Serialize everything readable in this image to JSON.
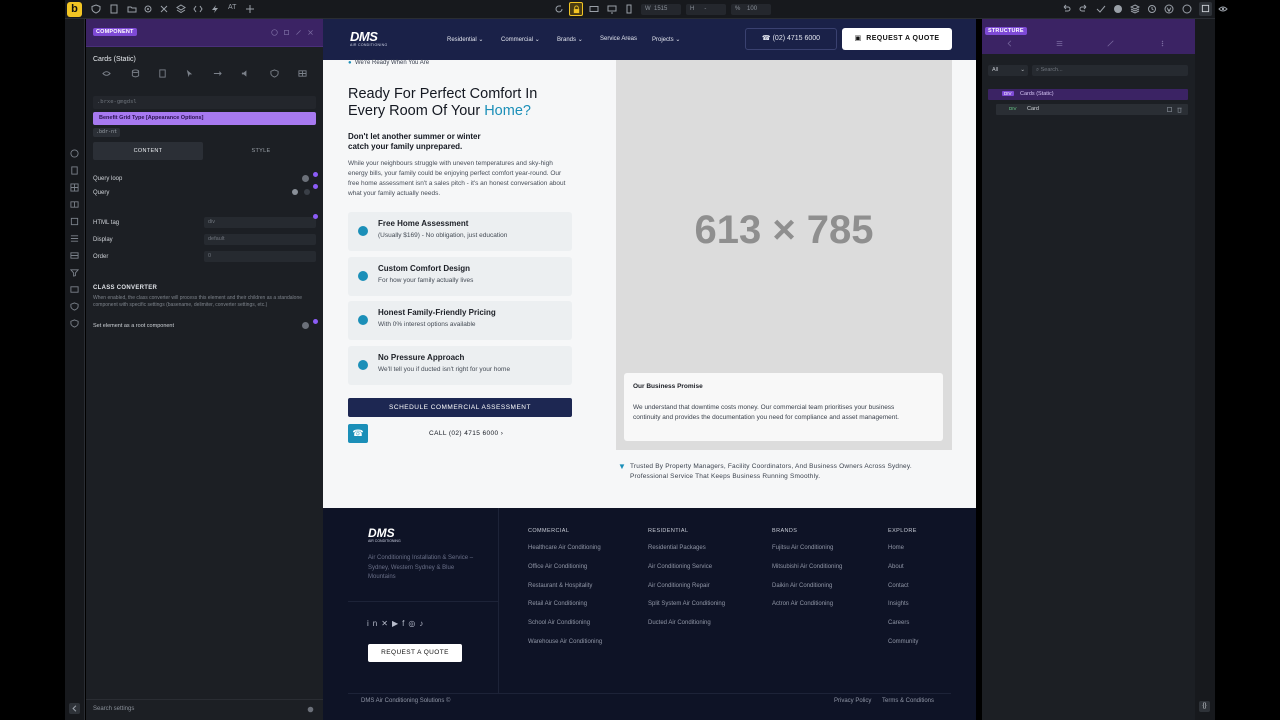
{
  "topbar": {
    "logo": "b",
    "mode": "AT",
    "width_value": "1515",
    "height_value": "-",
    "zoom_value": "100"
  },
  "left_panel": {
    "badge": "COMPONENT",
    "title": "Cards (Static)",
    "class_field": ".brxe-gmgdsl",
    "template_bar": "Benefit Grid Type [Appearance Options]",
    "tag_chip": ".bdr-nt",
    "tabs": {
      "content": "CONTENT",
      "style": "STYLE"
    },
    "fields": {
      "query_loop": "Query loop",
      "query": "Query",
      "html_tag": "HTML tag",
      "html_tag_value": "div",
      "display": "Display",
      "display_value": "default",
      "order": "Order",
      "order_value": "0"
    },
    "class_converter": {
      "heading": "CLASS CONVERTER",
      "desc": "When enabled, the class converter will process this element and their children as a standalone component with specific settings (basename, delimiter, converter settings, etc.)",
      "root_label": "Set element as a root component"
    },
    "search_placeholder": "Search settings"
  },
  "site": {
    "brand": "DMS",
    "brand_sub": "AIR CONDITIONING",
    "nav": [
      "Residential",
      "Commercial",
      "Brands",
      "Service Areas",
      "Projects"
    ],
    "phone": "(02) 4715 6000",
    "quote_button": "REQUEST A QUOTE",
    "hero": {
      "eyebrow": "We're Ready When You Are",
      "heading_line1": "Ready For Perfect Comfort In",
      "heading_line2": "Every Room Of Your ",
      "heading_accent": "Home?",
      "subheading": "Don't let another summer or winter catch your family unprepared.",
      "body": "While your neighbours struggle with uneven temperatures and sky-high energy bills, your family could be enjoying perfect comfort year-round. Our free home assessment isn't a sales pitch - it's an honest conversation about what your family actually needs.",
      "benefits": [
        {
          "title": "Free Home Assessment",
          "sub": "(Usually $169) - No obligation, just education"
        },
        {
          "title": "Custom Comfort Design",
          "sub": "For how your family actually lives"
        },
        {
          "title": "Honest Family-Friendly Pricing",
          "sub": "With 0% interest options available"
        },
        {
          "title": "No Pressure Approach",
          "sub": "We'll tell you if ducted isn't right for your home"
        }
      ],
      "cta_button": "SCHEDULE COMMERCIAL ASSESSMENT",
      "call_link": "CALL (02) 4715 6000",
      "placeholder": "613 × 785",
      "promise_title": "Our Business Promise",
      "promise_body": "We understand that downtime costs money. Our commercial team prioritises your business continuity and provides the documentation you need for compliance and asset management.",
      "trusted": "Trusted By Property Managers, Facility Coordinators, And Business Owners Across Sydney. Professional Service That Keeps Business Running Smoothly."
    },
    "footer": {
      "tagline": "Air Conditioning Installation & Service – Sydney, Western Sydney & Blue Mountains",
      "quote_button": "REQUEST A QUOTE",
      "columns": [
        {
          "heading": "COMMERCIAL",
          "links": [
            "Healthcare Air Conditioning",
            "Office Air Conditioning",
            "Restaurant & Hospitality",
            "Retail Air Conditioning",
            "School Air Conditioning",
            "Warehouse Air Conditioning"
          ]
        },
        {
          "heading": "RESIDENTIAL",
          "links": [
            "Residential Packages",
            "Air Conditioning Service",
            "Air Conditioning Repair",
            "Split System Air Conditioning",
            "Ducted Air Conditioning"
          ]
        },
        {
          "heading": "BRANDS",
          "links": [
            "Fujitsu Air Conditioning",
            "Mitsubishi Air Conditioning",
            "Daikin Air Conditioning",
            "Actron Air Conditioning"
          ]
        },
        {
          "heading": "EXPLORE",
          "links": [
            "Home",
            "About",
            "Contact",
            "Insights",
            "Careers",
            "Community"
          ]
        }
      ],
      "copyright": "DMS Air Conditioning Solutions ©",
      "privacy": "Privacy Policy",
      "terms": "Terms & Conditions"
    }
  },
  "right_panel": {
    "badge": "STRUCTURE",
    "filter_value": "All",
    "search_placeholder": "Search...",
    "tree": [
      {
        "tag": "DIV",
        "label": "Cards (Static)"
      },
      {
        "tag": "DIV",
        "label": "Card"
      }
    ]
  },
  "colors": {
    "accent": "#8b5cf6",
    "nav_bg": "#1a2148",
    "teal": "#1b8fb8",
    "navy_button": "#1d2752"
  }
}
